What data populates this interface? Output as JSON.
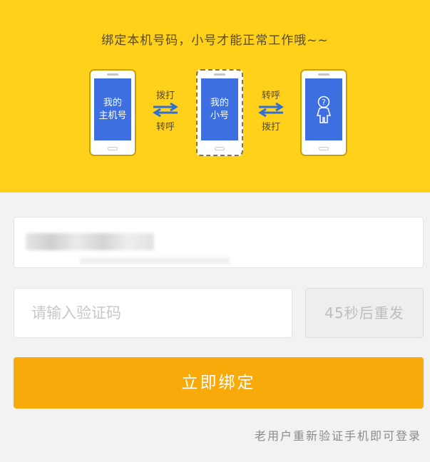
{
  "banner": {
    "title": "绑定本机号码，小号才能正常工作哦~~",
    "phones": [
      {
        "line1": "我的",
        "line2": "主机号"
      },
      {
        "line1": "我的",
        "line2": "小号"
      },
      {
        "icon": "person-question-icon"
      }
    ],
    "arrows": [
      {
        "top": "拨打",
        "bottom": "转呼"
      },
      {
        "top": "转呼",
        "bottom": "拨打"
      }
    ]
  },
  "form": {
    "code_placeholder": "请输入验证码",
    "resend_label": "45秒后重发",
    "bind_label": "立即绑定",
    "login_link": "老用户重新验证手机即可登录"
  },
  "colors": {
    "banner": "#ffd11a",
    "screen": "#3d6fe0",
    "primary": "#f9aa0b"
  }
}
